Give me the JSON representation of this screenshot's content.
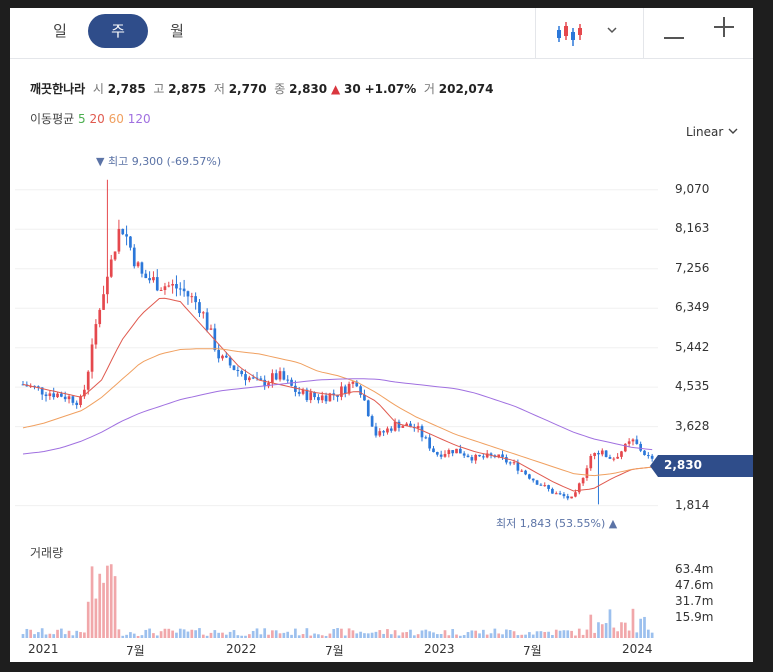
{
  "tabs": [
    {
      "label": "일",
      "active": false
    },
    {
      "label": "주",
      "active": true
    },
    {
      "label": "월",
      "active": false
    }
  ],
  "toolbar": {
    "chart_type_icon": "candlestick-icon",
    "dropdown_icon": "chevron-down-icon",
    "zoom_out_icon": "minus-icon",
    "zoom_in_icon": "plus-icon"
  },
  "stock": {
    "name": "깨끗한나라",
    "open_label": "시",
    "open": "2,785",
    "high_label": "고",
    "high": "2,875",
    "low_label": "저",
    "low": "2,770",
    "close_label": "종",
    "close": "2,830",
    "change_arrow": "▲",
    "change": "30",
    "change_pct": "+1.07%",
    "volume_label": "거",
    "volume": "202,074"
  },
  "ma_legend": {
    "label": "이동평균",
    "items": [
      {
        "period": "5",
        "color": "#4caf50"
      },
      {
        "period": "20",
        "color": "#e05a4f"
      },
      {
        "period": "60",
        "color": "#f0a060"
      },
      {
        "period": "120",
        "color": "#a070e0"
      }
    ]
  },
  "scale_selector": {
    "label": "Linear",
    "icon": "chevron-down-icon"
  },
  "annotations": {
    "high": {
      "text": "▼ 최고 9,300 (-69.57%)"
    },
    "low": {
      "text": "최저 1,843 (53.55%) ▲"
    }
  },
  "current_price_tag": "2,830",
  "volume_title": "거래량",
  "colors": {
    "up": "#e5484d",
    "down": "#2b77d9",
    "accent": "#2f4d8a"
  },
  "chart_data": {
    "type": "candlestick",
    "timeframe": "weekly",
    "price_axis": {
      "ticks": [
        9070,
        8163,
        7256,
        6349,
        5442,
        4535,
        3628,
        1814
      ],
      "range": [
        1300,
        9800
      ],
      "scale": "linear"
    },
    "x_axis": {
      "ticks": [
        "2021",
        "7월",
        "2022",
        "7월",
        "2023",
        "7월",
        "2024"
      ]
    },
    "volume_axis": {
      "ticks": [
        "63.4m",
        "47.6m",
        "31.7m",
        "15.9m"
      ]
    },
    "high_point": {
      "value": 9300,
      "pct": "-69.57%"
    },
    "low_point": {
      "value": 1843,
      "pct": "53.55%"
    },
    "last": {
      "open": 2785,
      "high": 2875,
      "low": 2770,
      "close": 2830
    },
    "price_path": [
      {
        "t": "2021-01",
        "close": 4600
      },
      {
        "t": "2021-02",
        "close": 4450
      },
      {
        "t": "2021-03",
        "close": 4350
      },
      {
        "t": "2021-04",
        "close": 4200
      },
      {
        "t": "2021-04b",
        "close": 6600
      },
      {
        "t": "2021-05",
        "close": 8300
      },
      {
        "t": "2021-05b",
        "close": 7100
      },
      {
        "t": "2021-06",
        "close": 6900
      },
      {
        "t": "2021-07",
        "close": 6800
      },
      {
        "t": "2021-08",
        "close": 6400
      },
      {
        "t": "2021-09",
        "close": 5200
      },
      {
        "t": "2021-10",
        "close": 4900
      },
      {
        "t": "2021-11",
        "close": 4600
      },
      {
        "t": "2021-12",
        "close": 4800
      },
      {
        "t": "2022-01",
        "close": 4400
      },
      {
        "t": "2022-03",
        "close": 4300
      },
      {
        "t": "2022-05",
        "close": 4400
      },
      {
        "t": "2022-06",
        "close": 4700
      },
      {
        "t": "2022-07",
        "close": 3400
      },
      {
        "t": "2022-08",
        "close": 3700
      },
      {
        "t": "2022-09",
        "close": 3600
      },
      {
        "t": "2022-10",
        "close": 3000
      },
      {
        "t": "2022-12",
        "close": 3100
      },
      {
        "t": "2023-02",
        "close": 2900
      },
      {
        "t": "2023-04",
        "close": 2950
      },
      {
        "t": "2023-06",
        "close": 2750
      },
      {
        "t": "2023-08",
        "close": 2400
      },
      {
        "t": "2023-10",
        "close": 2100
      },
      {
        "t": "2023-11",
        "close": 1950
      },
      {
        "t": "2023-12",
        "close": 3100
      },
      {
        "t": "2024-01",
        "close": 2900
      },
      {
        "t": "2024-02",
        "close": 3300
      },
      {
        "t": "2024-03",
        "close": 2830
      }
    ],
    "ma": [
      {
        "period": 20,
        "values": [
          4600,
          4500,
          4400,
          4300,
          4700,
          5600,
          6200,
          6600,
          6500,
          6000,
          5500,
          5000,
          4700,
          4600,
          4500,
          4400,
          4350,
          4450,
          4200,
          3700,
          3600,
          3400,
          3200,
          3050,
          2950,
          2850,
          2600,
          2350,
          2150,
          2200,
          2450,
          2650,
          2700
        ]
      },
      {
        "period": 60,
        "values": [
          3600,
          3700,
          3850,
          4000,
          4300,
          4700,
          5100,
          5300,
          5400,
          5420,
          5420,
          5350,
          5300,
          5200,
          5100,
          4900,
          4800,
          4650,
          4400,
          4100,
          3850,
          3650,
          3450,
          3300,
          3150,
          3000,
          2850,
          2700,
          2550,
          2500,
          2550,
          2650,
          2700
        ]
      },
      {
        "period": 120,
        "values": [
          3000,
          3050,
          3150,
          3300,
          3500,
          3750,
          3950,
          4100,
          4250,
          4350,
          4450,
          4500,
          4550,
          4600,
          4650,
          4700,
          4720,
          4730,
          4720,
          4650,
          4600,
          4550,
          4500,
          4400,
          4250,
          4100,
          3900,
          3700,
          3500,
          3350,
          3250,
          3150,
          3100
        ]
      }
    ]
  }
}
